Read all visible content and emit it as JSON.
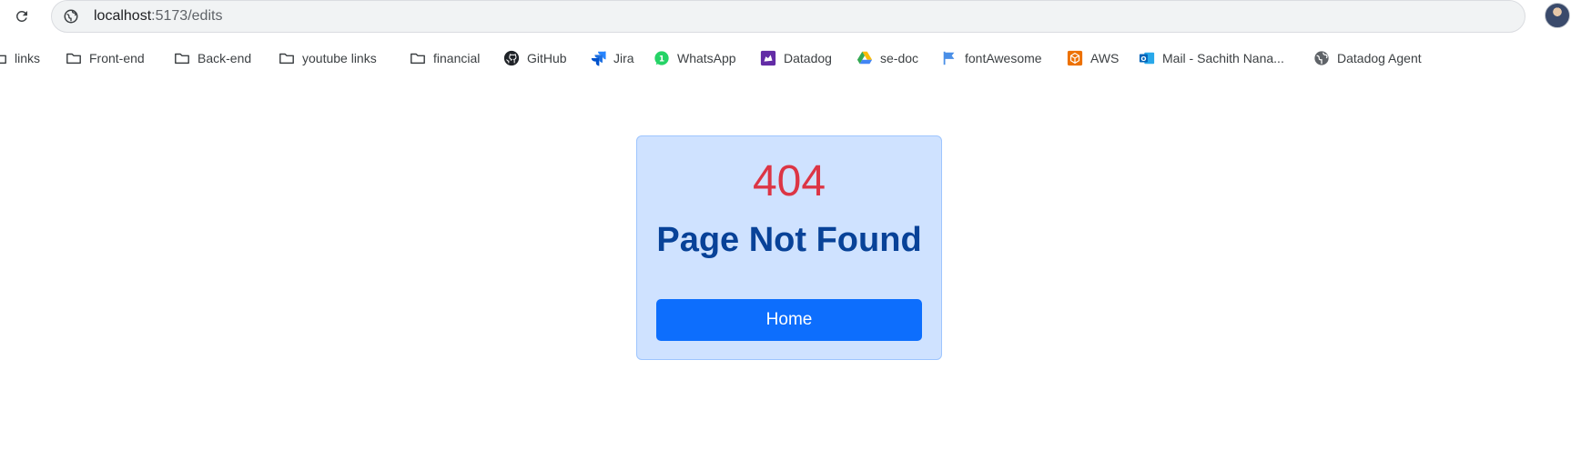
{
  "browser": {
    "url_host": "localhost",
    "url_path": ":5173/edits"
  },
  "bookmarks": [
    {
      "label": "links",
      "icon": "folder-icon"
    },
    {
      "label": "Front-end",
      "icon": "folder-icon"
    },
    {
      "label": "Back-end",
      "icon": "folder-icon"
    },
    {
      "label": "youtube links",
      "icon": "folder-icon"
    },
    {
      "label": "financial",
      "icon": "folder-icon"
    },
    {
      "label": "GitHub",
      "icon": "github-icon"
    },
    {
      "label": "Jira",
      "icon": "jira-icon"
    },
    {
      "label": "WhatsApp",
      "icon": "whatsapp-icon"
    },
    {
      "label": "Datadog",
      "icon": "datadog-icon"
    },
    {
      "label": "se-doc",
      "icon": "google-drive-icon"
    },
    {
      "label": "fontAwesome",
      "icon": "flag-icon"
    },
    {
      "label": "AWS",
      "icon": "aws-icon"
    },
    {
      "label": "Mail - Sachith Nana...",
      "icon": "outlook-icon"
    },
    {
      "label": "Datadog Agent",
      "icon": "globe-icon"
    }
  ],
  "card": {
    "code": "404",
    "title": "Page Not Found",
    "button_label": "Home"
  },
  "colors": {
    "card_bg": "#cfe2ff",
    "code": "#dc3545",
    "title": "#084298",
    "button": "#0d6efd"
  }
}
